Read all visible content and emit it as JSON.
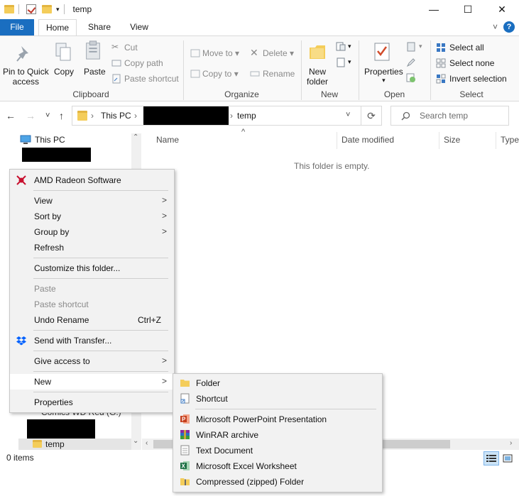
{
  "window": {
    "title": "temp",
    "minimize_glyph": "—",
    "maximize_glyph": "☐",
    "close_glyph": "✕",
    "qat_caret": "▾"
  },
  "tabs": {
    "file": "File",
    "home": "Home",
    "share": "Share",
    "view": "View",
    "collapse_glyph": "˅",
    "help_glyph": "?"
  },
  "ribbon": {
    "clipboard": {
      "label": "Clipboard",
      "pin_line1": "Pin to Quick",
      "pin_line2": "access",
      "copy": "Copy",
      "paste": "Paste",
      "cut": "Cut",
      "copy_path": "Copy path",
      "paste_shortcut": "Paste shortcut"
    },
    "organize": {
      "label": "Organize",
      "move_to": "Move to",
      "copy_to": "Copy to",
      "delete": "Delete",
      "rename": "Rename"
    },
    "new": {
      "label": "New",
      "new_folder_line1": "New",
      "new_folder_line2": "folder"
    },
    "open": {
      "label": "Open",
      "properties": "Properties"
    },
    "select": {
      "label": "Select",
      "select_all": "Select all",
      "select_none": "Select none",
      "invert_selection": "Invert selection"
    }
  },
  "nav": {
    "back_glyph": "←",
    "forward_glyph": "→",
    "recent_glyph": "˅",
    "up_glyph": "↑",
    "refresh_glyph": "⟳",
    "breadcrumb_sep": "›",
    "breadcrumb_root": "This PC",
    "breadcrumb_current": "temp",
    "dropdown_glyph": "˅",
    "search_placeholder": "Search temp"
  },
  "navpane": {
    "this_pc": "This PC",
    "drive_partial": "Comics WD Red (G:)",
    "temp_folder": "temp"
  },
  "columns": {
    "name": "Name",
    "date_modified": "Date modified",
    "size": "Size",
    "type": "Type",
    "sort_glyph": "^"
  },
  "content": {
    "empty_text": "This folder is empty."
  },
  "status": {
    "items": "0 items"
  },
  "context_menu": {
    "amd": "AMD Radeon Software",
    "view": "View",
    "sort_by": "Sort by",
    "group_by": "Group by",
    "refresh": "Refresh",
    "customize": "Customize this folder...",
    "paste": "Paste",
    "paste_shortcut": "Paste shortcut",
    "undo_rename": "Undo Rename",
    "undo_shortcut": "Ctrl+Z",
    "send_transfer": "Send with Transfer...",
    "give_access": "Give access to",
    "new": "New",
    "properties": "Properties",
    "arrow_glyph": ">"
  },
  "submenu_new": {
    "folder": "Folder",
    "shortcut": "Shortcut",
    "powerpoint": "Microsoft PowerPoint Presentation",
    "winrar": "WinRAR archive",
    "text_doc": "Text Document",
    "excel": "Microsoft Excel Worksheet",
    "zip": "Compressed (zipped) Folder"
  },
  "colors": {
    "file_tab": "#1a6ec0",
    "folder_yellow": "#f4cd5a",
    "menu_bg": "#f2f2f2"
  }
}
